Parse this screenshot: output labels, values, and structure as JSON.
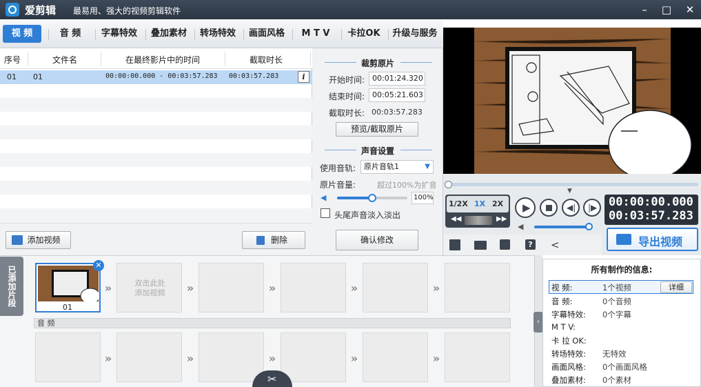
{
  "app": {
    "title": "爱剪辑",
    "slogan": "最易用、强大的视频剪辑软件"
  },
  "window": {
    "minimize": "–",
    "maximize": "□",
    "close": "✕"
  },
  "tabs": [
    "视 频",
    "音 频",
    "字幕特效",
    "叠加素材",
    "转场特效",
    "画面风格",
    "M T V",
    "卡拉OK",
    "升级与服务"
  ],
  "clip_list": {
    "headers": [
      "序号",
      "文件名",
      "在最终影片中的时间",
      "截取时长"
    ],
    "rows": [
      {
        "index": "01",
        "file": "01",
        "time": "00:00:00.000 - 00:03:57.283",
        "duration": "00:03:57.283",
        "info": "i"
      }
    ],
    "add_button": "添加视频",
    "delete_button": "删除"
  },
  "trim": {
    "section_title": "裁剪原片",
    "start_label": "开始时间:",
    "start_value": "00:01:24.320",
    "end_label": "结束时间:",
    "end_value": "00:05:21.603",
    "cut_label": "截取时长:",
    "cut_value": "00:03:57.283",
    "preview_button": "预览/截取原片",
    "sound_title": "声音设置",
    "track_label": "使用音轨:",
    "track_value": "原片音轨1",
    "volume_label": "原片音量:",
    "volume_hint": "超过100%为扩音",
    "volume_value": "100%",
    "volume_level": 0.5,
    "fade_label": "头尾声音淡入淡出",
    "confirm_button": "确认修改"
  },
  "player": {
    "speeds": [
      "1/2X",
      "1X",
      "2X"
    ],
    "current_time": "00:00:00.000",
    "total_time": "00:03:57.283",
    "progress": 0.0,
    "volume_level": 1.0,
    "export_button": "导出视频"
  },
  "timeline": {
    "side_label": "已添加片段",
    "clip_label": "01",
    "add_hint": "双击此处\n添加视频",
    "audio_label": "音 频"
  },
  "info": {
    "title": "所有制作的信息:",
    "detail_button": "详细",
    "rows": [
      {
        "label": "视    频:",
        "value": "1个视频"
      },
      {
        "label": "音    频:",
        "value": "0个音频"
      },
      {
        "label": "字幕特效:",
        "value": "0个字幕"
      },
      {
        "label": "M  T  V:",
        "value": ""
      },
      {
        "label": "卡 拉 OK:",
        "value": ""
      },
      {
        "label": "转场特效:",
        "value": "无特效"
      },
      {
        "label": "画面风格:",
        "value": "0个画面风格"
      },
      {
        "label": "叠加素材:",
        "value": "0个素材"
      }
    ]
  },
  "colors": {
    "accent": "#2f7ed6",
    "titlebar": "#2c3643",
    "selected_row": "#bcd8f4"
  }
}
